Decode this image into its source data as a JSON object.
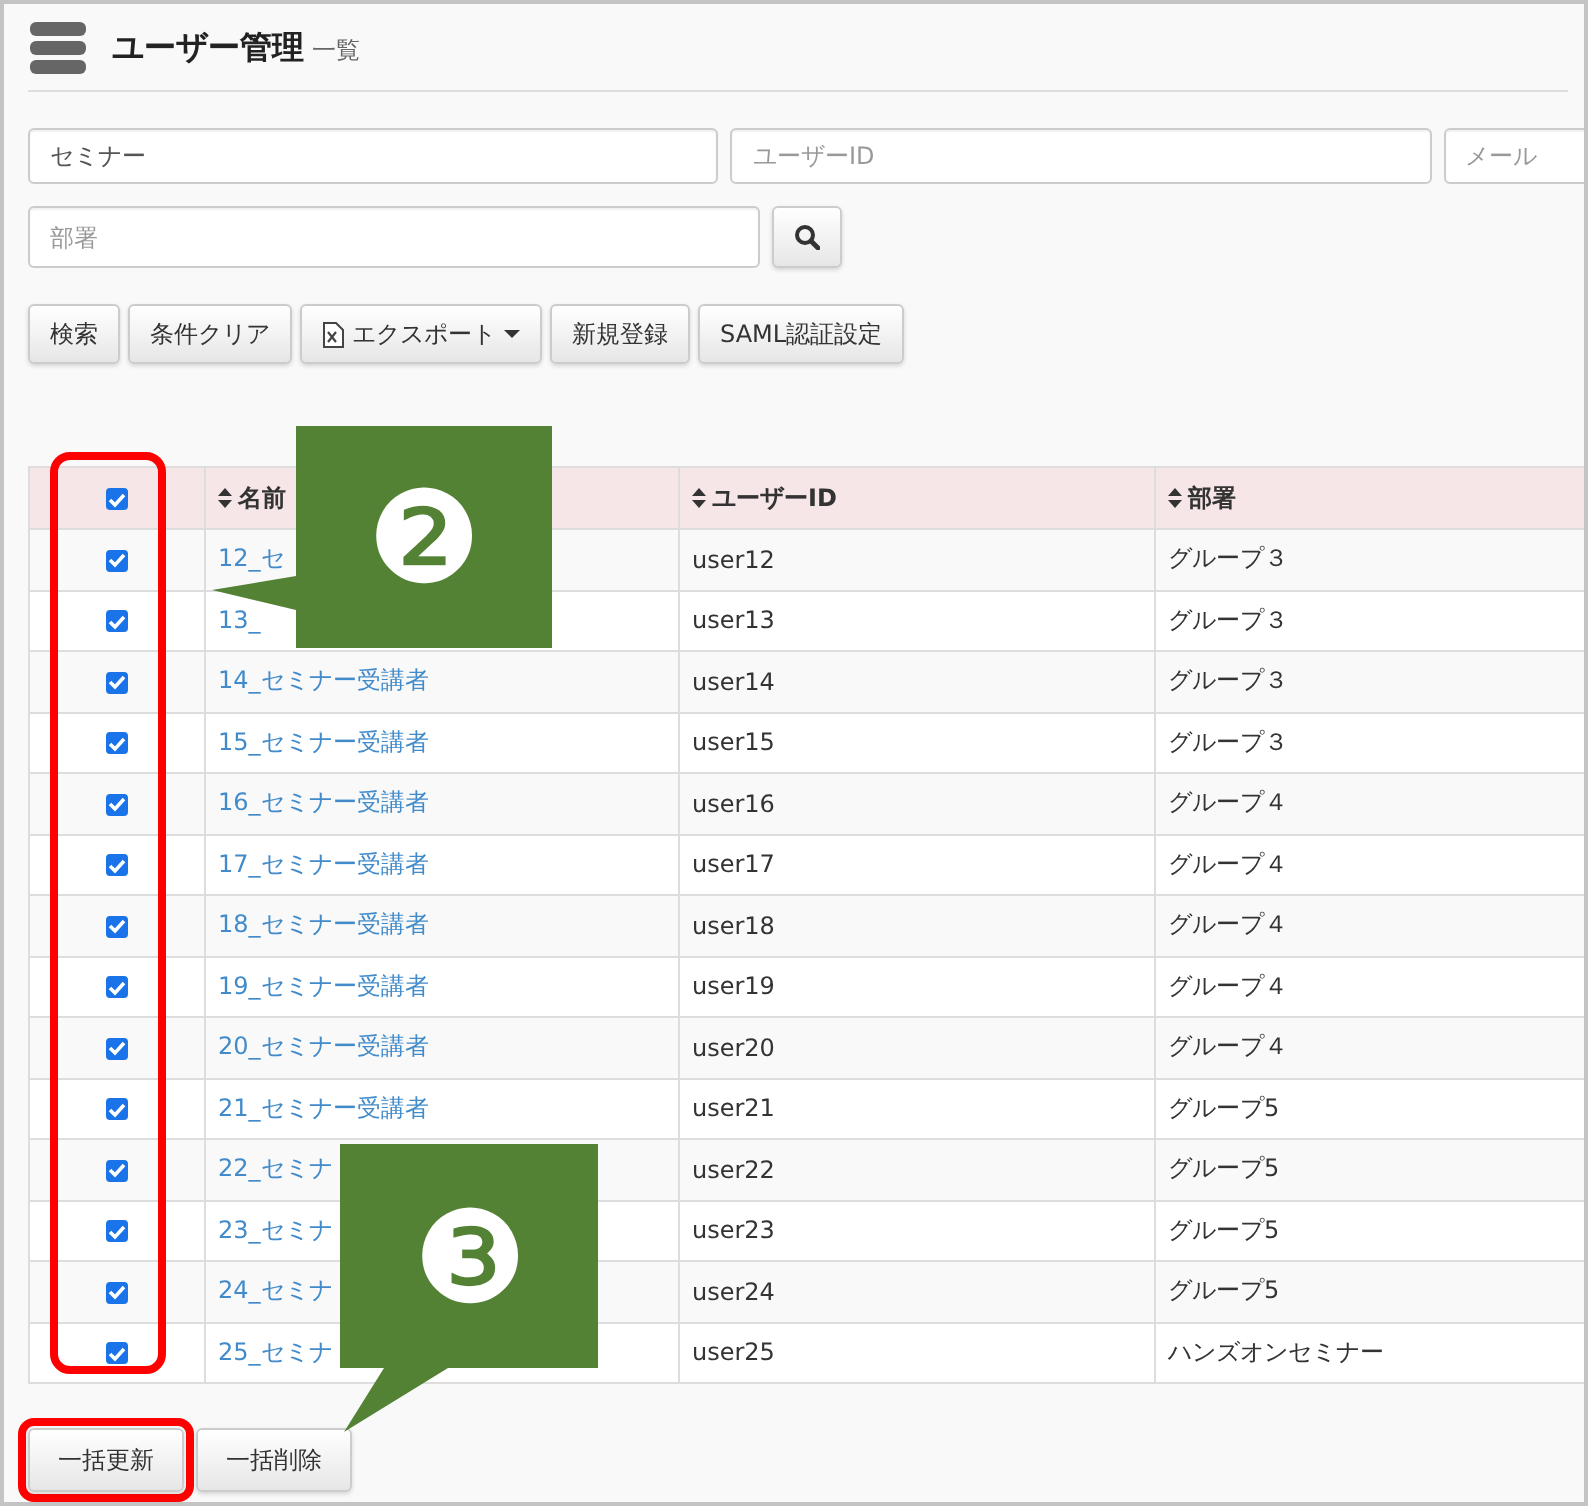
{
  "header": {
    "title": "ユーザー管理",
    "subtitle": "一覧"
  },
  "filter_rows": [
    [
      {
        "kind": "text",
        "value": "セミナー"
      },
      {
        "kind": "text",
        "placeholder": "ユーザーID"
      },
      {
        "kind": "text",
        "placeholder": "メール"
      }
    ],
    [
      {
        "kind": "text",
        "placeholder": "部署"
      },
      {
        "kind": "search"
      }
    ]
  ],
  "toolbar": [
    {
      "kind": "plain",
      "label": "検索"
    },
    {
      "kind": "plain",
      "label": "条件クリア"
    },
    {
      "kind": "dropdown",
      "label": "エクスポート"
    },
    {
      "kind": "plain",
      "label": "新規登録"
    },
    {
      "kind": "plain",
      "label": "SAML認証設定"
    }
  ],
  "table": {
    "select_all": {
      "checked": true
    },
    "checkbox_column_highlighted": true,
    "columns": [
      "名前",
      "ユーザーID",
      "部署"
    ],
    "rows": [
      {
        "checked": true,
        "name": "12_セ",
        "user_id": "user12",
        "department": "グループ３"
      },
      {
        "checked": true,
        "name": "13_",
        "user_id": "user13",
        "department": "グループ３"
      },
      {
        "checked": true,
        "name": "14_セミナー受講者",
        "user_id": "user14",
        "department": "グループ３"
      },
      {
        "checked": true,
        "name": "15_セミナー受講者",
        "user_id": "user15",
        "department": "グループ３"
      },
      {
        "checked": true,
        "name": "16_セミナー受講者",
        "user_id": "user16",
        "department": "グループ４"
      },
      {
        "checked": true,
        "name": "17_セミナー受講者",
        "user_id": "user17",
        "department": "グループ４"
      },
      {
        "checked": true,
        "name": "18_セミナー受講者",
        "user_id": "user18",
        "department": "グループ４"
      },
      {
        "checked": true,
        "name": "19_セミナー受講者",
        "user_id": "user19",
        "department": "グループ４"
      },
      {
        "checked": true,
        "name": "20_セミナー受講者",
        "user_id": "user20",
        "department": "グループ４"
      },
      {
        "checked": true,
        "name": "21_セミナー受講者",
        "user_id": "user21",
        "department": "グループ5"
      },
      {
        "checked": true,
        "name": "22_セミナ",
        "user_id": "user22",
        "department": "グループ5"
      },
      {
        "checked": true,
        "name": "23_セミナ",
        "user_id": "user23",
        "department": "グループ5"
      },
      {
        "checked": true,
        "name": "24_セミナ",
        "user_id": "user24",
        "department": "グループ5"
      },
      {
        "checked": true,
        "name": "25_セミナ",
        "user_id": "user25",
        "department": "ハンズオンセミナー"
      }
    ]
  },
  "bulk_actions": [
    {
      "label": "一括更新",
      "highlighted": true
    },
    {
      "label": "一括削除",
      "highlighted": false
    }
  ],
  "callouts": [
    {
      "label": "❷"
    },
    {
      "label": "❸"
    }
  ]
}
